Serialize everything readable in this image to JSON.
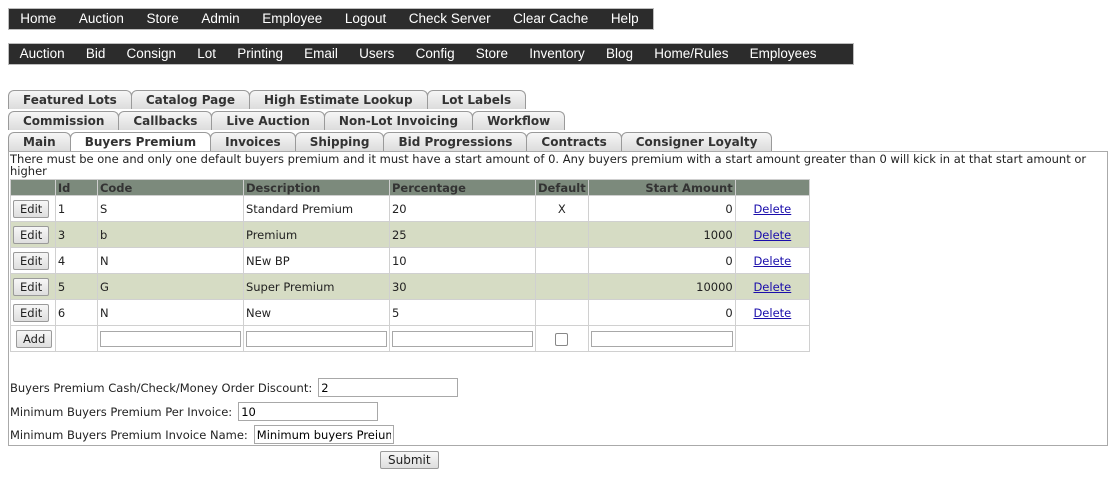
{
  "main_menu": [
    "Home",
    "Auction",
    "Store",
    "Admin",
    "Employee",
    "Logout",
    "Check Server",
    "Clear Cache",
    "Help"
  ],
  "sub_menu": [
    "Auction",
    "Bid",
    "Consign",
    "Lot",
    "Printing",
    "Email",
    "Users",
    "Config",
    "Store",
    "Inventory",
    "Blog",
    "Home/Rules",
    "Employees"
  ],
  "tabs": {
    "row1": [
      "Featured Lots",
      "Catalog Page",
      "High Estimate Lookup",
      "Lot Labels"
    ],
    "row2": [
      "Commission",
      "Callbacks",
      "Live Auction",
      "Non-Lot Invoicing",
      "Workflow"
    ],
    "row3": [
      "Main",
      "Buyers Premium",
      "Invoices",
      "Shipping",
      "Bid Progressions",
      "Contracts",
      "Consigner Loyalty"
    ],
    "active": "Buyers Premium"
  },
  "notice": "There must be one and only one default buyers premium and it must have a start amount of 0. Any buyers premium with a start amount greater than 0 will kick in at that start amount or higher",
  "table": {
    "headers": {
      "id": "Id",
      "code": "Code",
      "description": "Description",
      "percentage": "Percentage",
      "default": "Default",
      "start_amount": "Start Amount"
    },
    "edit_label": "Edit",
    "delete_label": "Delete",
    "add_label": "Add",
    "rows": [
      {
        "id": "1",
        "code": "S",
        "description": "Standard Premium",
        "percentage": "20",
        "default": "X",
        "start_amount": "0"
      },
      {
        "id": "3",
        "code": "b",
        "description": "Premium",
        "percentage": "25",
        "default": "",
        "start_amount": "1000"
      },
      {
        "id": "4",
        "code": "N",
        "description": "NEw BP",
        "percentage": "10",
        "default": "",
        "start_amount": "0"
      },
      {
        "id": "5",
        "code": "G",
        "description": "Super Premium",
        "percentage": "30",
        "default": "",
        "start_amount": "10000"
      },
      {
        "id": "6",
        "code": "N",
        "description": "New",
        "percentage": "5",
        "default": "",
        "start_amount": "0"
      }
    ]
  },
  "form": {
    "discount_label": "Buyers Premium Cash/Check/Money Order Discount:",
    "discount_value": "2",
    "min_per_invoice_label": "Minimum Buyers Premium Per Invoice:",
    "min_per_invoice_value": "10",
    "invoice_name_label": "Minimum Buyers Premium Invoice Name:",
    "invoice_name_value": "Minimum buyers Preium",
    "submit_label": "Submit"
  },
  "colors": {
    "menu_bg": "#2c2c2c",
    "table_header_bg": "#7c8a7c",
    "alt_row_bg": "#d6dcc4",
    "link": "#1a0dab"
  }
}
